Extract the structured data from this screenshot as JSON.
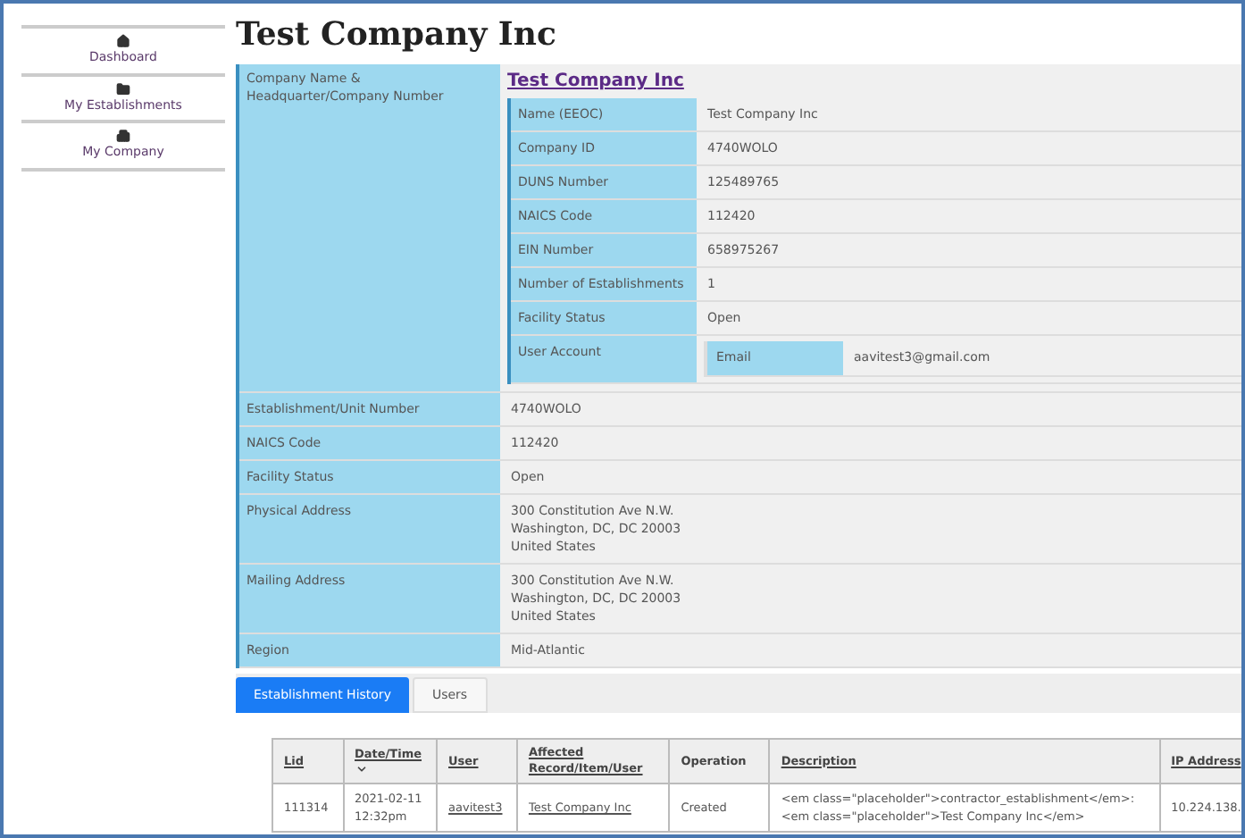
{
  "sidebar": {
    "items": [
      {
        "label": "Dashboard"
      },
      {
        "label": "My Establishments"
      },
      {
        "label": "My Company"
      }
    ]
  },
  "page_title": "Test Company Inc",
  "company": {
    "label": "Company Name & Headquarter/Company Number",
    "link": "Test Company Inc",
    "details": [
      {
        "label": "Name (EEOC)",
        "value": "Test Company Inc"
      },
      {
        "label": "Company ID",
        "value": "4740WOLO"
      },
      {
        "label": "DUNS Number",
        "value": "125489765"
      },
      {
        "label": "NAICS Code",
        "value": "112420"
      },
      {
        "label": "EIN Number",
        "value": "658975267"
      },
      {
        "label": "Number of Establishments",
        "value": "1"
      },
      {
        "label": "Facility Status",
        "value": "Open"
      },
      {
        "label": "User Account",
        "account": {
          "label": "Email",
          "value": "aavitest3@gmail.com"
        }
      }
    ]
  },
  "fields": [
    {
      "label": "Establishment/Unit Number",
      "lines": [
        "4740WOLO"
      ]
    },
    {
      "label": "NAICS Code",
      "lines": [
        "112420"
      ]
    },
    {
      "label": "Facility Status",
      "lines": [
        "Open"
      ]
    },
    {
      "label": "Physical Address",
      "lines": [
        "300 Constitution Ave N.W.",
        "Washington, DC, DC 20003",
        "United States"
      ]
    },
    {
      "label": "Mailing Address",
      "lines": [
        "300 Constitution Ave N.W.",
        "Washington, DC, DC 20003",
        "United States"
      ]
    },
    {
      "label": "Region",
      "lines": [
        "Mid-Atlantic"
      ]
    }
  ],
  "tabs": [
    {
      "label": "Establishment History",
      "selected": true
    },
    {
      "label": "Users",
      "selected": false
    }
  ],
  "history": {
    "columns": [
      {
        "label": "Lid",
        "sortable": true,
        "sorted": false
      },
      {
        "label": "Date/Time",
        "sortable": true,
        "sorted": true
      },
      {
        "label": "User",
        "sortable": true,
        "sorted": false
      },
      {
        "label": "Affected Record/Item/User",
        "sortable": true,
        "sorted": false
      },
      {
        "label": "Operation",
        "sortable": false,
        "sorted": false
      },
      {
        "label": "Description",
        "sortable": true,
        "sorted": false
      },
      {
        "label": "IP Address",
        "sortable": true,
        "sorted": false
      }
    ],
    "rows": [
      {
        "cells": [
          {
            "kind": "text",
            "text": "111314"
          },
          {
            "kind": "text",
            "text": "2021-02-11 12:32pm"
          },
          {
            "kind": "link",
            "text": "aavitest3"
          },
          {
            "kind": "link",
            "text": "Test Company Inc"
          },
          {
            "kind": "text",
            "text": "Created"
          },
          {
            "kind": "text",
            "text": "<em class=\"placeholder\">contractor_establishment</em>: <em class=\"placeholder\">Test Company Inc</em>"
          },
          {
            "kind": "text",
            "text": "10.224.138."
          }
        ]
      }
    ]
  }
}
